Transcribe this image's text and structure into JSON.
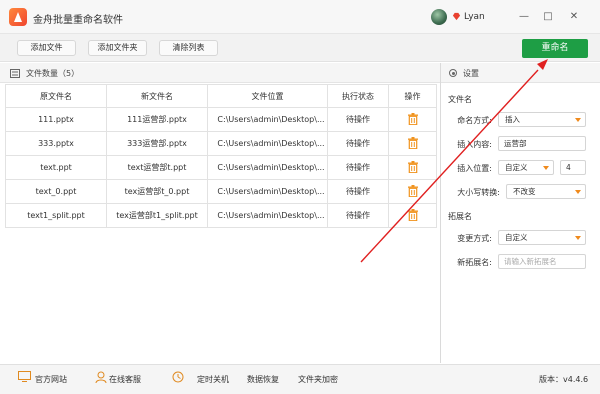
{
  "app": {
    "title": "金舟批量重命名软件",
    "username": "Lyan"
  },
  "window_controls": {
    "minimize": "—",
    "maximize": "□",
    "close": "✕"
  },
  "toolbar": {
    "add_file": "添加文件",
    "add_folder": "添加文件夹",
    "clear_list": "清除列表",
    "rename": "重命名"
  },
  "file_list": {
    "title": "文件数量（5）",
    "columns": [
      "原文件名",
      "新文件名",
      "文件位置",
      "执行状态",
      "操作"
    ],
    "rows": [
      {
        "original": "111.pptx",
        "new": "111运营部.pptx",
        "path": "C:\\Users\\admin\\Desktop\\...",
        "status": "待操作"
      },
      {
        "original": "333.pptx",
        "new": "333运营部.pptx",
        "path": "C:\\Users\\admin\\Desktop\\...",
        "status": "待操作"
      },
      {
        "original": "text.ppt",
        "new": "text运营部t.ppt",
        "path": "C:\\Users\\admin\\Desktop\\...",
        "status": "待操作"
      },
      {
        "original": "text_0.ppt",
        "new": "tex运营部t_0.ppt",
        "path": "C:\\Users\\admin\\Desktop\\...",
        "status": "待操作"
      },
      {
        "original": "text1_split.ppt",
        "new": "tex运营部t1_split.ppt",
        "path": "C:\\Users\\admin\\Desktop\\...",
        "status": "待操作"
      }
    ]
  },
  "settings": {
    "title": "设置",
    "filename_section": "文件名",
    "naming_mode_label": "命名方式:",
    "naming_mode_value": "插入",
    "insert_content_label": "插入内容:",
    "insert_content_value": "运营部",
    "insert_position_label": "插入位置:",
    "insert_position_value": "自定义",
    "insert_position_number": "4",
    "case_label": "大小写转换:",
    "case_value": "不改变",
    "extension_section": "拓展名",
    "change_mode_label": "变更方式:",
    "change_mode_value": "自定义",
    "new_ext_label": "新拓展名:",
    "new_ext_placeholder": "请输入新拓展名"
  },
  "statusbar": {
    "website": "官方网站",
    "support": "在线客服",
    "shutdown": "定时关机",
    "recovery": "数据恢复",
    "encrypt": "文件夹加密",
    "version": "版本：v4.4.6"
  },
  "colors": {
    "accent_green": "#1e9e45",
    "arrow_red": "#e02020",
    "caret_orange": "#f08a1c"
  },
  "icons": [
    "app-logo-icon",
    "avatar",
    "vip-diamond-icon",
    "list-icon",
    "trash-icon",
    "settings-radio-icon",
    "website-icon",
    "support-icon",
    "shutdown-icon",
    "annotation-arrow"
  ]
}
